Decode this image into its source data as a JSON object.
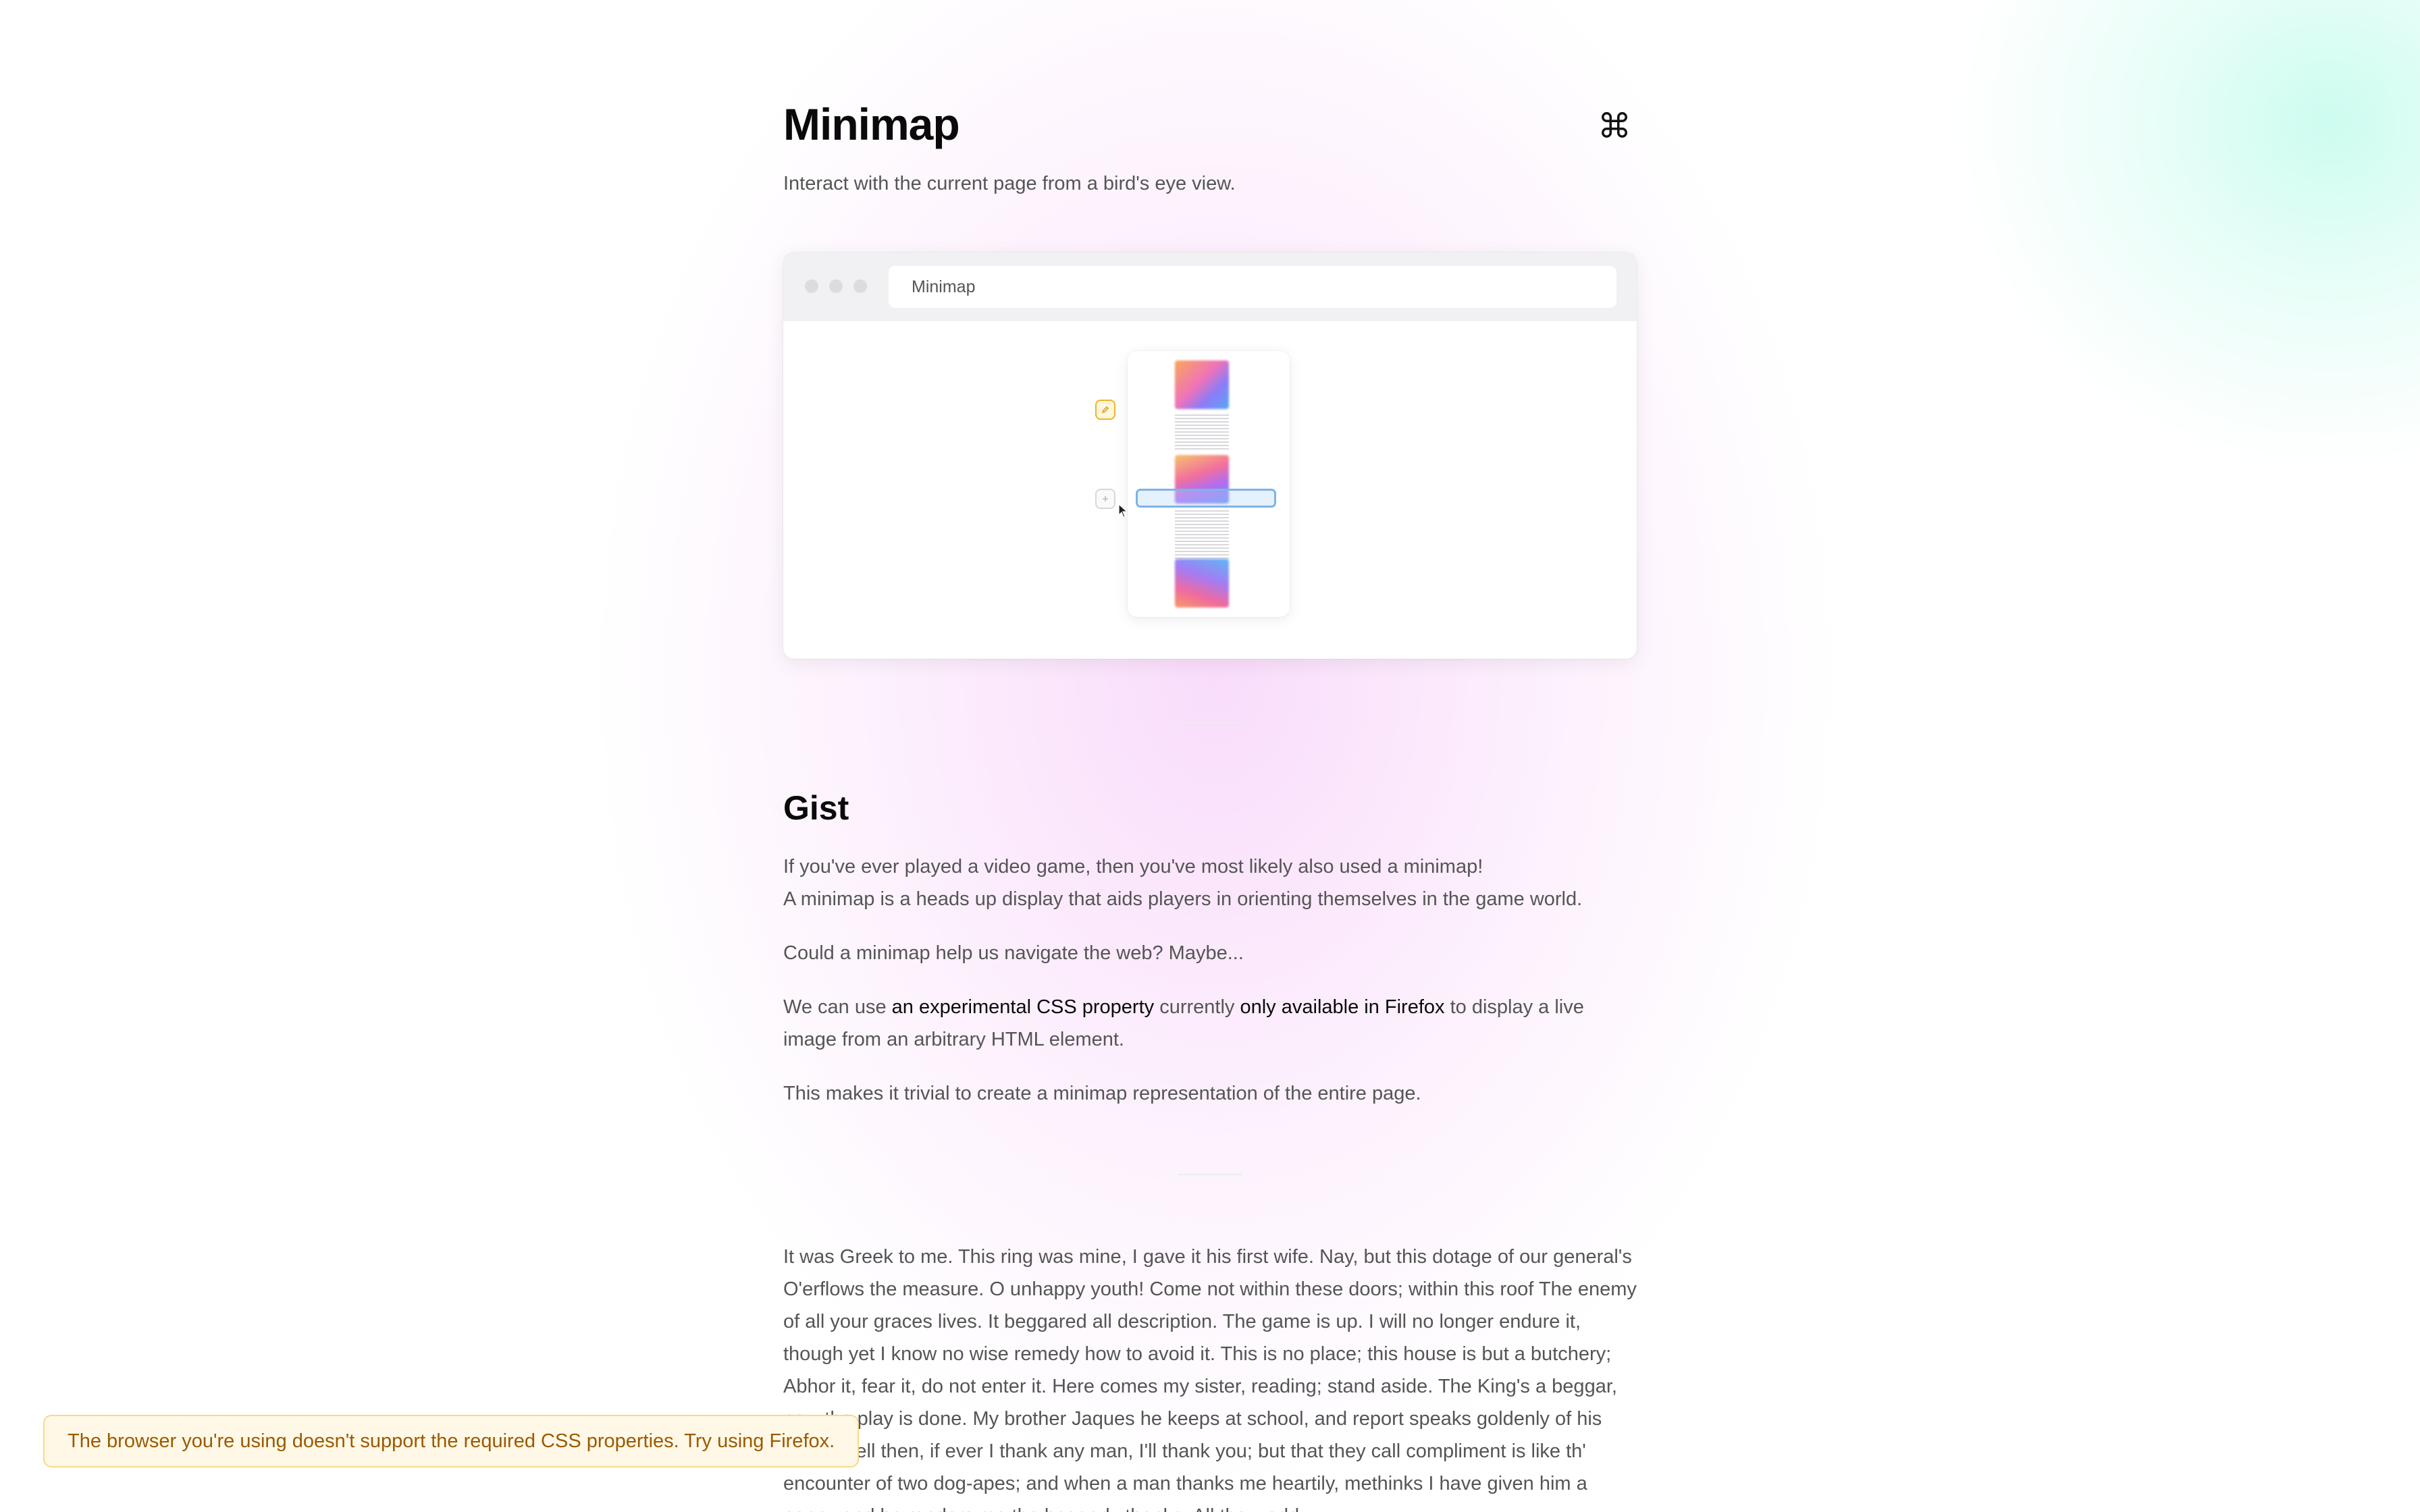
{
  "header": {
    "title": "Minimap",
    "subtitle": "Interact with the current page from a bird's eye view.",
    "command_icon": "command-icon"
  },
  "demo": {
    "url_label": "Minimap",
    "window_dots": [
      "window-dot-icon",
      "window-dot-icon",
      "window-dot-icon"
    ],
    "side_icons": [
      "pencil-note-icon",
      "plus-icon"
    ],
    "cursor_icon": "cursor-arrow-icon"
  },
  "gist": {
    "heading": "Gist",
    "p1_line1": "If you've ever played a video game, then you've most likely also used a minimap!",
    "p1_line2": "A minimap is a heads up display that aids players in orienting themselves in the game world.",
    "p2": "Could a minimap help us navigate the web? Maybe...",
    "p3_pre": "We can use ",
    "p3_link1": "an experimental CSS property",
    "p3_mid": " currently ",
    "p3_link2": "only available in Firefox",
    "p3_post": " to display a live image from an arbitrary HTML element.",
    "p4": "This makes it trivial to create a minimap representation of the entire page."
  },
  "prose": {
    "text": "It was Greek to me. This ring was mine, I gave it his first wife. Nay, but this dotage of our general's O'erflows the measure. O unhappy youth! Come not within these doors; within this roof The enemy of all your graces lives. It beggared all description. The game is up. I will no longer endure it, though yet I know no wise remedy how to avoid it. This is no place; this house is but a butchery; Abhor it, fear it, do not enter it. Here comes my sister, reading; stand aside. The King's a beggar, now the play is done. My brother Jaques he keeps at school, and report speaks goldenly of his profit. Well then, if ever I thank any man, I'll thank you; but that they call compliment is like th' encounter of two dog-apes; and when a man thanks me heartily, methinks I have given him a penny and he renders me the beggarly thanks. All the world"
  },
  "toast": {
    "message": "The browser you're using doesn't support the required CSS properties. Try using Firefox."
  },
  "colors": {
    "accent_blue": "#7db4e6",
    "warning_bg": "#fff8e6",
    "warning_text": "#9a5a00",
    "note_icon": "#f0b429"
  }
}
